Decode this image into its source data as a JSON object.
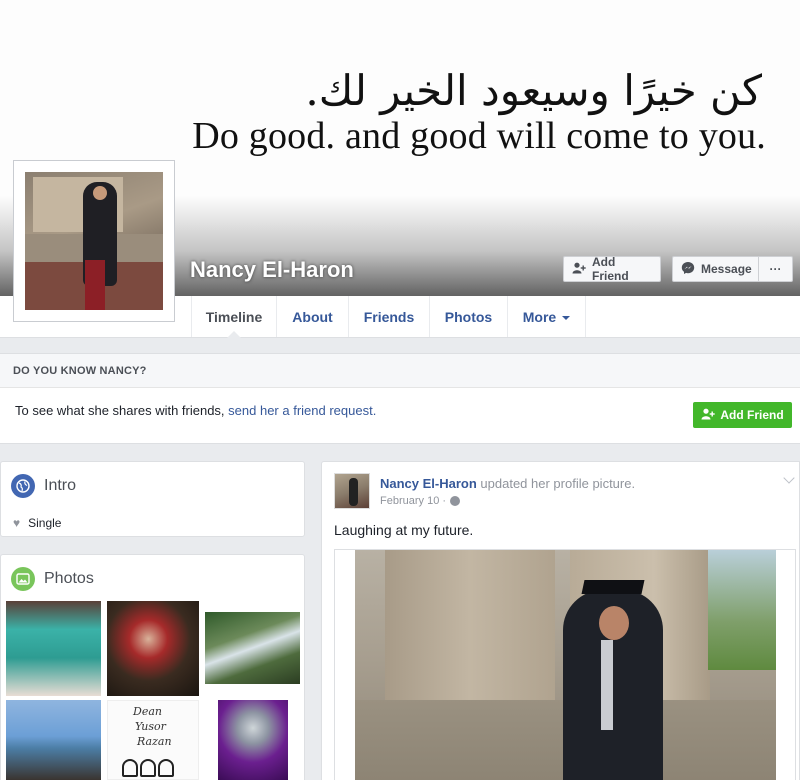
{
  "cover": {
    "quote_ar": "كن خيرًا وسيعود الخير لك.",
    "quote_en": "Do good. and good will come to you."
  },
  "profile": {
    "name": "Nancy El-Haron"
  },
  "actions": {
    "add_friend": "Add Friend",
    "message": "Message",
    "more": "···"
  },
  "nav": {
    "tabs": [
      "Timeline",
      "About",
      "Friends",
      "Photos",
      "More"
    ],
    "active": "Timeline"
  },
  "know": {
    "heading": "DO YOU KNOW NANCY?",
    "text_before": "To see what she shares with friends, ",
    "link": "send her a friend request.",
    "button": "Add Friend"
  },
  "intro": {
    "title": "Intro",
    "relationship": "Single"
  },
  "photos": {
    "title": "Photos",
    "note_lines": [
      "Dean",
      "Yusor",
      "Razan"
    ]
  },
  "post": {
    "author": "Nancy El-Haron",
    "action": " updated her profile picture.",
    "date": "February 10 · ",
    "text": "Laughing at my future."
  },
  "colors": {
    "link": "#365899",
    "green": "#42b72a",
    "background": "#e9ebee",
    "blue_icon": "#4267b2"
  },
  "icons": {
    "add_friend": "person-plus-icon",
    "message": "messenger-icon",
    "intro": "globe-icon",
    "photos": "photo-icon",
    "relationship": "heart-icon",
    "privacy": "globe-small-icon",
    "post_menu": "chevron-down-icon"
  }
}
